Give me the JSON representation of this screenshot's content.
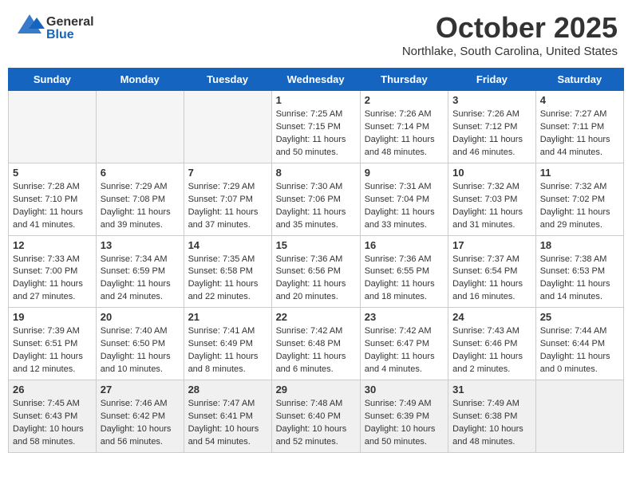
{
  "header": {
    "logo_general": "General",
    "logo_blue": "Blue",
    "month_title": "October 2025",
    "location": "Northlake, South Carolina, United States"
  },
  "days_of_week": [
    "Sunday",
    "Monday",
    "Tuesday",
    "Wednesday",
    "Thursday",
    "Friday",
    "Saturday"
  ],
  "weeks": [
    [
      {
        "day": "",
        "info": ""
      },
      {
        "day": "",
        "info": ""
      },
      {
        "day": "",
        "info": ""
      },
      {
        "day": "1",
        "info": "Sunrise: 7:25 AM\nSunset: 7:15 PM\nDaylight: 11 hours and 50 minutes."
      },
      {
        "day": "2",
        "info": "Sunrise: 7:26 AM\nSunset: 7:14 PM\nDaylight: 11 hours and 48 minutes."
      },
      {
        "day": "3",
        "info": "Sunrise: 7:26 AM\nSunset: 7:12 PM\nDaylight: 11 hours and 46 minutes."
      },
      {
        "day": "4",
        "info": "Sunrise: 7:27 AM\nSunset: 7:11 PM\nDaylight: 11 hours and 44 minutes."
      }
    ],
    [
      {
        "day": "5",
        "info": "Sunrise: 7:28 AM\nSunset: 7:10 PM\nDaylight: 11 hours and 41 minutes."
      },
      {
        "day": "6",
        "info": "Sunrise: 7:29 AM\nSunset: 7:08 PM\nDaylight: 11 hours and 39 minutes."
      },
      {
        "day": "7",
        "info": "Sunrise: 7:29 AM\nSunset: 7:07 PM\nDaylight: 11 hours and 37 minutes."
      },
      {
        "day": "8",
        "info": "Sunrise: 7:30 AM\nSunset: 7:06 PM\nDaylight: 11 hours and 35 minutes."
      },
      {
        "day": "9",
        "info": "Sunrise: 7:31 AM\nSunset: 7:04 PM\nDaylight: 11 hours and 33 minutes."
      },
      {
        "day": "10",
        "info": "Sunrise: 7:32 AM\nSunset: 7:03 PM\nDaylight: 11 hours and 31 minutes."
      },
      {
        "day": "11",
        "info": "Sunrise: 7:32 AM\nSunset: 7:02 PM\nDaylight: 11 hours and 29 minutes."
      }
    ],
    [
      {
        "day": "12",
        "info": "Sunrise: 7:33 AM\nSunset: 7:00 PM\nDaylight: 11 hours and 27 minutes."
      },
      {
        "day": "13",
        "info": "Sunrise: 7:34 AM\nSunset: 6:59 PM\nDaylight: 11 hours and 24 minutes."
      },
      {
        "day": "14",
        "info": "Sunrise: 7:35 AM\nSunset: 6:58 PM\nDaylight: 11 hours and 22 minutes."
      },
      {
        "day": "15",
        "info": "Sunrise: 7:36 AM\nSunset: 6:56 PM\nDaylight: 11 hours and 20 minutes."
      },
      {
        "day": "16",
        "info": "Sunrise: 7:36 AM\nSunset: 6:55 PM\nDaylight: 11 hours and 18 minutes."
      },
      {
        "day": "17",
        "info": "Sunrise: 7:37 AM\nSunset: 6:54 PM\nDaylight: 11 hours and 16 minutes."
      },
      {
        "day": "18",
        "info": "Sunrise: 7:38 AM\nSunset: 6:53 PM\nDaylight: 11 hours and 14 minutes."
      }
    ],
    [
      {
        "day": "19",
        "info": "Sunrise: 7:39 AM\nSunset: 6:51 PM\nDaylight: 11 hours and 12 minutes."
      },
      {
        "day": "20",
        "info": "Sunrise: 7:40 AM\nSunset: 6:50 PM\nDaylight: 11 hours and 10 minutes."
      },
      {
        "day": "21",
        "info": "Sunrise: 7:41 AM\nSunset: 6:49 PM\nDaylight: 11 hours and 8 minutes."
      },
      {
        "day": "22",
        "info": "Sunrise: 7:42 AM\nSunset: 6:48 PM\nDaylight: 11 hours and 6 minutes."
      },
      {
        "day": "23",
        "info": "Sunrise: 7:42 AM\nSunset: 6:47 PM\nDaylight: 11 hours and 4 minutes."
      },
      {
        "day": "24",
        "info": "Sunrise: 7:43 AM\nSunset: 6:46 PM\nDaylight: 11 hours and 2 minutes."
      },
      {
        "day": "25",
        "info": "Sunrise: 7:44 AM\nSunset: 6:44 PM\nDaylight: 11 hours and 0 minutes."
      }
    ],
    [
      {
        "day": "26",
        "info": "Sunrise: 7:45 AM\nSunset: 6:43 PM\nDaylight: 10 hours and 58 minutes."
      },
      {
        "day": "27",
        "info": "Sunrise: 7:46 AM\nSunset: 6:42 PM\nDaylight: 10 hours and 56 minutes."
      },
      {
        "day": "28",
        "info": "Sunrise: 7:47 AM\nSunset: 6:41 PM\nDaylight: 10 hours and 54 minutes."
      },
      {
        "day": "29",
        "info": "Sunrise: 7:48 AM\nSunset: 6:40 PM\nDaylight: 10 hours and 52 minutes."
      },
      {
        "day": "30",
        "info": "Sunrise: 7:49 AM\nSunset: 6:39 PM\nDaylight: 10 hours and 50 minutes."
      },
      {
        "day": "31",
        "info": "Sunrise: 7:49 AM\nSunset: 6:38 PM\nDaylight: 10 hours and 48 minutes."
      },
      {
        "day": "",
        "info": ""
      }
    ]
  ]
}
